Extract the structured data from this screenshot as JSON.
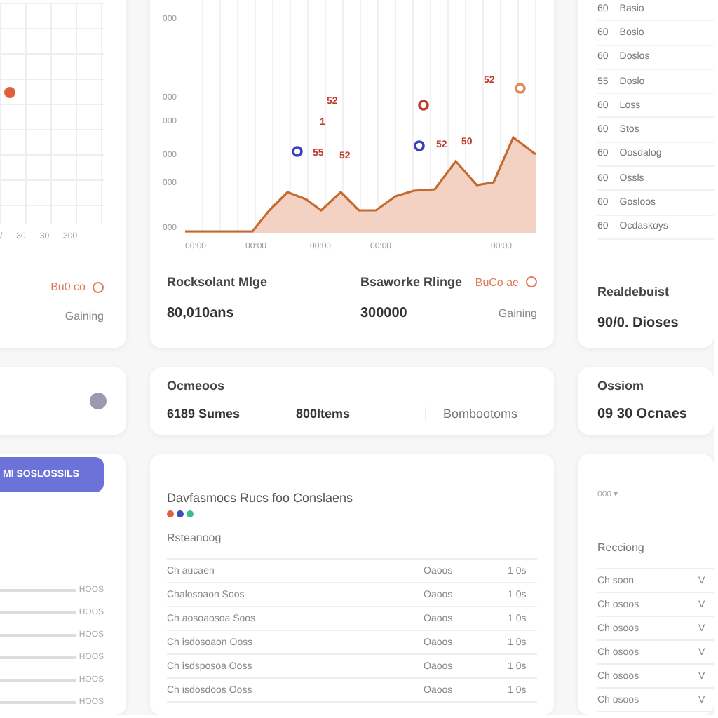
{
  "left_top": {
    "x_labels": [
      "/",
      "30",
      "30",
      "300"
    ],
    "badge": "Bu0 co",
    "note": "Gaining"
  },
  "chart_panel": {
    "y_labels": [
      "000",
      "000",
      "000",
      "000",
      "000",
      "000"
    ],
    "x_labels": [
      "00:00",
      "00:00",
      "00:00",
      "00:00",
      "00:00"
    ],
    "markers": [
      {
        "kind": "tag",
        "label": "52",
        "color": "#c0392b"
      },
      {
        "kind": "tag",
        "label": "1",
        "color": "#c0392b"
      },
      {
        "kind": "dot",
        "color": "#3a3fc0"
      },
      {
        "kind": "tag",
        "label": "55",
        "color": "#c0392b"
      },
      {
        "kind": "tag",
        "label": "52",
        "color": "#c0392b"
      },
      {
        "kind": "dot",
        "color": "#c0392b"
      },
      {
        "kind": "dot",
        "color": "#3a3fc0"
      },
      {
        "kind": "tag",
        "label": "52",
        "color": "#c0392b"
      },
      {
        "kind": "tag",
        "label": "50",
        "color": "#c0392b"
      },
      {
        "kind": "tag",
        "label": "52",
        "color": "#c0392b"
      },
      {
        "kind": "dot",
        "color": "#e08a5a"
      }
    ],
    "stats": [
      {
        "title": "Rocksolant Mlge",
        "value": "80,010ans"
      },
      {
        "title": "Bsaworke Rlinge",
        "value": "300000",
        "badge": "BuCo ae",
        "note": "Gaining"
      }
    ]
  },
  "right_top": {
    "rows": [
      {
        "num": "60",
        "label": "Basio"
      },
      {
        "num": "60",
        "label": "Bosio"
      },
      {
        "num": "60",
        "label": "Doslos"
      },
      {
        "num": "55",
        "label": "Doslo"
      },
      {
        "num": "60",
        "label": "Loss"
      },
      {
        "num": "60",
        "label": "Stos"
      },
      {
        "num": "60",
        "label": "Oosdalog"
      },
      {
        "num": "60",
        "label": "Ossls"
      },
      {
        "num": "60",
        "label": "Gosloos"
      },
      {
        "num": "60",
        "label": "Ocdaskoys"
      }
    ],
    "title": "Realdebuist",
    "value": "90/0. Dioses"
  },
  "left_mid": {
    "kind": "info"
  },
  "summary": {
    "title": "Ocmeoos",
    "values": [
      "6189 Sumes",
      "800Items",
      "Bombootoms"
    ]
  },
  "right_mid": {
    "title": "Ossiom",
    "value": "09 30 Ocnaes"
  },
  "left_bottom": {
    "button": "Ml SOSLOSSILS",
    "rows": [
      "HOOS",
      "HOOS",
      "HOOS",
      "HOOS",
      "HOOS",
      "HOOS"
    ]
  },
  "table_panel": {
    "title": "Davfasmocs Rucs foo Conslaens",
    "legend": [
      {
        "color": "#e0603a"
      },
      {
        "color": "#3a4fc0"
      },
      {
        "color": "#3ac08a"
      }
    ],
    "subtitle": "Rsteanoog",
    "rows": [
      [
        "Ch aucaen",
        "Oaoos",
        "1 0s"
      ],
      [
        "Chalosoaon Soos",
        "Oaoos",
        "1 0s"
      ],
      [
        "Ch aosoaosoa Soos",
        "Oaoos",
        "1 0s"
      ],
      [
        "Ch isdosoaon Ooss",
        "Oaoos",
        "1 0s"
      ],
      [
        "Ch isdsposoa Ooss",
        "Oaoos",
        "1 0s"
      ],
      [
        "Ch isdosdoos Ooss",
        "Oaoos",
        "1 0s"
      ]
    ]
  },
  "right_bottom": {
    "select": "000 ▾",
    "subtitle": "Recciong",
    "rows": [
      [
        "Ch soon",
        "V"
      ],
      [
        "Ch osoos",
        "V"
      ],
      [
        "Ch osoos",
        "V"
      ],
      [
        "Ch osoos",
        "V"
      ],
      [
        "Ch osoos",
        "V"
      ],
      [
        "Ch osoos",
        "V"
      ]
    ]
  }
}
